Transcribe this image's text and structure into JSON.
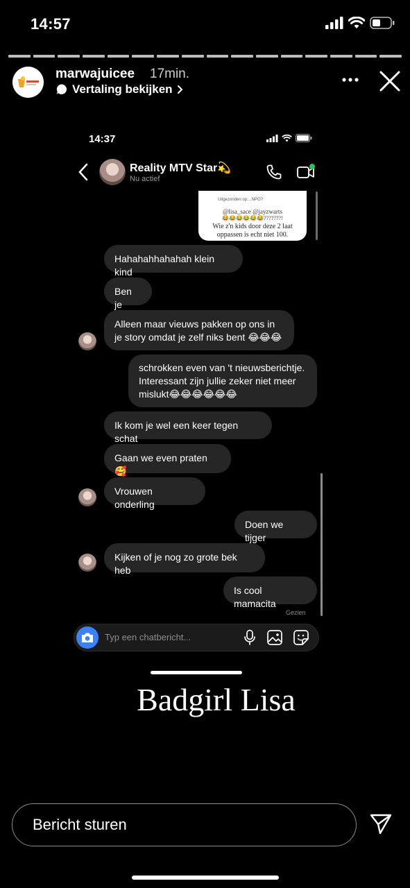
{
  "os": {
    "time": "14:57"
  },
  "story": {
    "progress_segments": 16,
    "username": "marwajuicee",
    "time_ago": "17min.",
    "translate_label": "Vertaling bekijken",
    "caption": "Badgirl Lisa",
    "reply_placeholder": "Bericht sturen"
  },
  "inner": {
    "time": "14:37",
    "chat_name": "Reality MTV Star💫",
    "chat_status": "Nu actief",
    "shared_post": {
      "top_text": "Uitgezonden op....NPO?",
      "tags": "@lisa_sace @jayzwarts",
      "emojis": "😂😂😂😂😂😂???????!",
      "line1": "Wie z'n kids door deze 2 laat",
      "line2": "oppassen is echt niet 100."
    },
    "messages": [
      {
        "text": "Hahahahhahahah klein kind",
        "side": "in"
      },
      {
        "text": "Ben je",
        "side": "in"
      },
      {
        "text": "Alleen maar vieuws pakken op ons in je story omdat je zelf niks bent 😂😂😂",
        "side": "in"
      },
      {
        "text": "schrokken even van 't nieuwsberichtje. Interessant zijn jullie zeker niet meer mislukt😂😂😂😂😂😂",
        "side": "out"
      },
      {
        "text": "Ik kom je wel een keer tegen schat",
        "side": "in"
      },
      {
        "text": "Gaan we even praten 🥰",
        "side": "in"
      },
      {
        "text": "Vrouwen onderling",
        "side": "in"
      },
      {
        "text": "Doen we tijger",
        "side": "out"
      },
      {
        "text": "Kijken of je nog zo grote bek heb",
        "side": "in"
      },
      {
        "text": "Is cool mamacita",
        "side": "out"
      }
    ],
    "seen_label": "Gezien",
    "composer_placeholder": "Typ een chatbericht..."
  },
  "colors": {
    "bubble": "#262626",
    "background": "#000000",
    "camera_button": "#3b82f6",
    "online_dot": "#22c55e"
  }
}
